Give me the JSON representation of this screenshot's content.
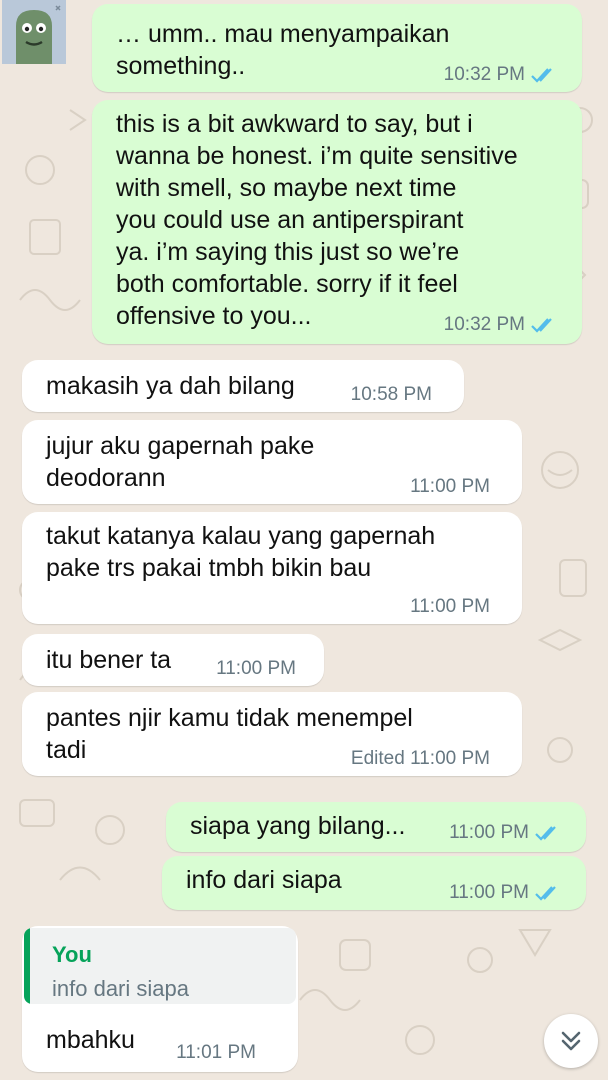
{
  "colors": {
    "background": "#efe7de",
    "outgoing_bubble": "#d9fdd3",
    "incoming_bubble": "#ffffff",
    "read_ticks": "#53bdeb",
    "quote_accent": "#06a35a",
    "timestamp": "#667781"
  },
  "messages": [
    {
      "direction": "outgoing",
      "text": "… umm.. mau menyampaikan\nsomething..",
      "time": "10:32 PM",
      "status": "read"
    },
    {
      "direction": "outgoing",
      "text": "this is a bit awkward to say, but i\nwanna be honest. i’m quite sensitive\nwith smell, so maybe next time\nyou could use an antiperspirant\nya. i’m saying this just so we’re\nboth comfortable. sorry if it feel\noffensive to you...",
      "time": "10:32 PM",
      "status": "read"
    },
    {
      "direction": "incoming",
      "text": "makasih ya dah bilang",
      "time": "10:58 PM"
    },
    {
      "direction": "incoming",
      "text": "   jujur aku gapernah pake\ndeodorann",
      "time": "11:00 PM"
    },
    {
      "direction": "incoming",
      "text": "takut katanya kalau yang gapernah\npake trs pakai tmbh bikin bau",
      "time": "11:00 PM"
    },
    {
      "direction": "incoming",
      "text": "itu bener ta",
      "time": "11:00 PM"
    },
    {
      "direction": "incoming",
      "text": "pantes njir kamu tidak menempel\ntadi",
      "time": "Edited 11:00 PM"
    },
    {
      "direction": "outgoing",
      "text": "siapa yang bilang...",
      "time": "11:00 PM",
      "status": "read"
    },
    {
      "direction": "outgoing",
      "text": "info dari siapa",
      "time": "11:00 PM",
      "status": "read"
    },
    {
      "direction": "incoming",
      "text": "mbahku",
      "time": "11:01 PM",
      "reply_to": {
        "name": "You",
        "text": "info dari siapa"
      }
    }
  ],
  "icons": {
    "avatar": "avatar-icon",
    "read_receipt": "double-check-icon",
    "scroll_down": "double-chevron-down-icon"
  }
}
